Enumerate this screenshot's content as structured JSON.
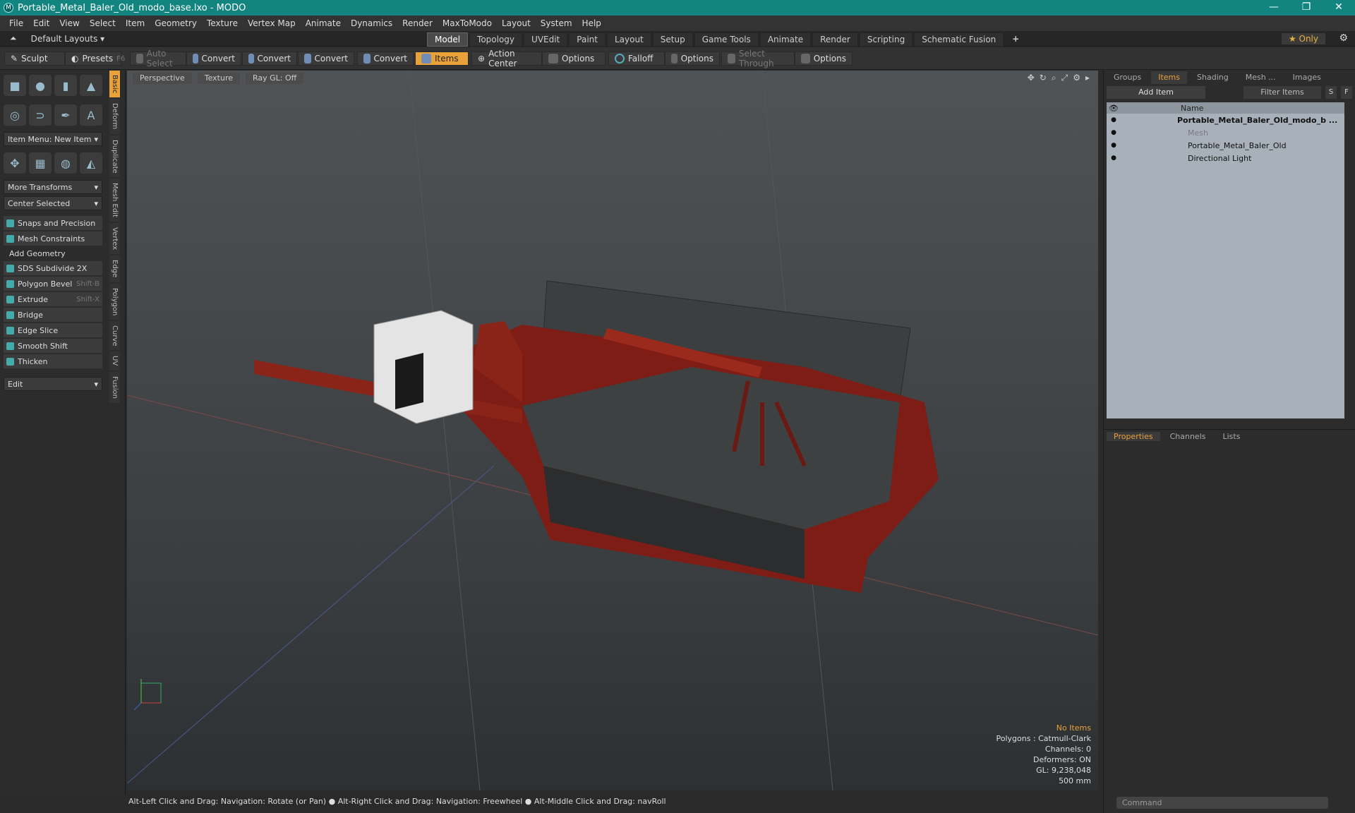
{
  "window": {
    "title": "Portable_Metal_Baler_Old_modo_base.lxo - MODO",
    "minimize": "—",
    "maximize": "❐",
    "close": "✕"
  },
  "menu": [
    "File",
    "Edit",
    "View",
    "Select",
    "Item",
    "Geometry",
    "Texture",
    "Vertex Map",
    "Animate",
    "Dynamics",
    "Render",
    "MaxToModo",
    "Layout",
    "System",
    "Help"
  ],
  "layout": {
    "layouts_label": "Default Layouts ▾",
    "tabs": [
      "Model",
      "Topology",
      "UVEdit",
      "Paint",
      "Layout",
      "Setup",
      "Game Tools",
      "Animate",
      "Render",
      "Scripting",
      "Schematic Fusion"
    ],
    "active_tab": "Model",
    "plus": "+",
    "only": "★ Only"
  },
  "toolbar": {
    "sculpt": "Sculpt",
    "presets": "Presets",
    "presets_key": "F6",
    "auto_select": "Auto Select",
    "convert1": "Convert",
    "convert2": "Convert",
    "convert3": "Convert",
    "convert4": "Convert",
    "items": "Items",
    "action_center": "Action Center",
    "options1": "Options",
    "falloff": "Falloff",
    "options2": "Options",
    "select_through": "Select Through",
    "options3": "Options"
  },
  "left": {
    "item_menu": "Item Menu: New Item",
    "more_transforms": "More Transforms",
    "center_selected": "Center Selected",
    "snaps": "Snaps and Precision",
    "mesh_constraints": "Mesh Constraints",
    "add_geometry": "Add Geometry",
    "tools": [
      {
        "label": "SDS Subdivide 2X",
        "shortcut": ""
      },
      {
        "label": "Polygon Bevel",
        "shortcut": "Shift-B"
      },
      {
        "label": "Extrude",
        "shortcut": "Shift-X"
      },
      {
        "label": "Bridge",
        "shortcut": ""
      },
      {
        "label": "Edge Slice",
        "shortcut": ""
      },
      {
        "label": "Smooth Shift",
        "shortcut": ""
      },
      {
        "label": "Thicken",
        "shortcut": ""
      }
    ],
    "edit": "Edit",
    "vtabs": [
      "Basic",
      "Deform",
      "Duplicate",
      "Mesh Edit",
      "Vertex",
      "Edge",
      "Polygon",
      "Curve",
      "UV",
      "Fusion"
    ]
  },
  "viewport": {
    "perspective": "Perspective",
    "texture": "Texture",
    "raygl": "Ray GL: Off",
    "stats": {
      "no_items": "No Items",
      "polygons": "Polygons : Catmull-Clark",
      "channels": "Channels: 0",
      "deformers": "Deformers: ON",
      "gl": "GL: 9,238,048",
      "scale": "500 mm"
    }
  },
  "status": "Alt-Left Click and Drag: Navigation: Rotate (or Pan) ● Alt-Right Click and Drag: Navigation: Freewheel ● Alt-Middle Click and Drag: navRoll",
  "right": {
    "tabs": [
      "Groups",
      "Items",
      "Shading",
      "Mesh ...",
      "Images"
    ],
    "active_tab": "Items",
    "add_item": "Add Item",
    "filter": "Filter Items",
    "s": "S",
    "f": "F",
    "col_name": "Name",
    "tree": [
      {
        "label": "Portable_Metal_Baler_Old_modo_b ...",
        "indent": 0,
        "style": "bold"
      },
      {
        "label": "Mesh",
        "indent": 1,
        "style": "dim"
      },
      {
        "label": "Portable_Metal_Baler_Old",
        "indent": 1,
        "style": "normal"
      },
      {
        "label": "Directional Light",
        "indent": 1,
        "style": "normal"
      }
    ],
    "ptabs": [
      "Properties",
      "Channels",
      "Lists"
    ],
    "command": "Command"
  }
}
